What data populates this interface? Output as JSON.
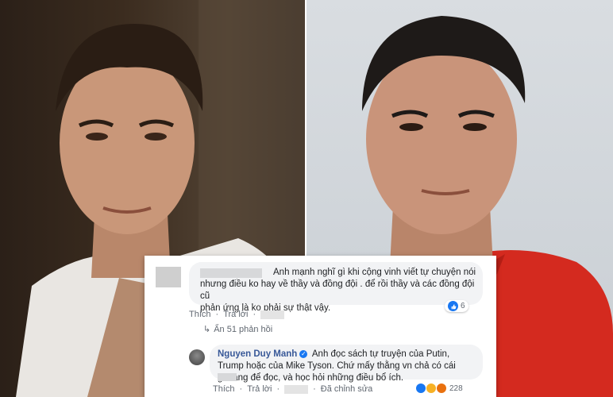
{
  "comment1": {
    "author_hidden": true,
    "text_line1": "Anh mạnh nghĩ gì khi cộng vinh viết tự chuyện nói",
    "text_line2": "nhưng điều ko hay về thầy và đồng đội . để rồi thầy và các đồng đội cũ",
    "text_line3": "phản ứng là ko phải sự thật vậy.",
    "like_action": "Thích",
    "reply_action": "Trả lời",
    "reaction_count": "6"
  },
  "replies_link": {
    "label": "Ẩn 51 phản hồi"
  },
  "reply": {
    "author": "Nguyen Duy Manh",
    "text_line1": "Anh đọc sách tự truyện của Putin,",
    "text_line2": "Trump hoặc của Mike Tyson. Chứ mấy thằng vn chả có cái",
    "text_line3": "gì đáng để đọc, và học hỏi những điều bổ ích.",
    "like_action": "Thích",
    "reply_action": "Trả lời",
    "edited_label": "Đã chỉnh sửa",
    "reaction_count": "228"
  },
  "colors": {
    "facebook_blue": "#1877f2",
    "link_blue": "#385898",
    "bubble_bg": "#f2f3f5",
    "jersey_red": "#d42a1f"
  }
}
